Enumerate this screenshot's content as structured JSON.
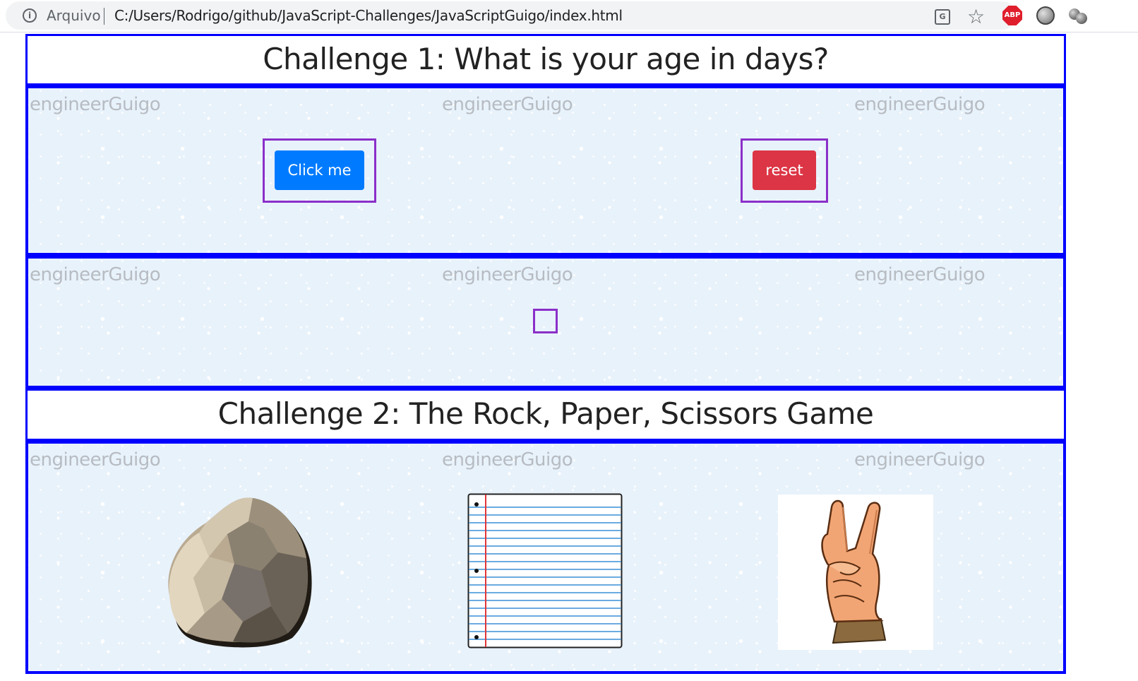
{
  "browser": {
    "scheme_label": "Arquivo",
    "url": "C:/Users/Rodrigo/github/JavaScript-Challenges/JavaScriptGuigo/index.html",
    "icons": [
      "info-icon",
      "translate-icon",
      "bookmark-star-icon",
      "adblock-plus-icon",
      "extension-film-icon",
      "extension-balls-icon"
    ],
    "abp_label": "ABP"
  },
  "watermark": "engineerGuigo",
  "challenge1": {
    "title": "Challenge 1: What is your age in days?",
    "click_label": "Click me",
    "reset_label": "reset",
    "result_text": ""
  },
  "challenge2": {
    "title": "Challenge 2: The Rock, Paper, Scissors Game",
    "choices": [
      "rock",
      "paper",
      "scissors"
    ]
  },
  "colors": {
    "border": "#0000ff",
    "frame": "#8b2fc9",
    "primary": "#007bff",
    "danger": "#dc3545",
    "background": "#e8f2fb"
  }
}
